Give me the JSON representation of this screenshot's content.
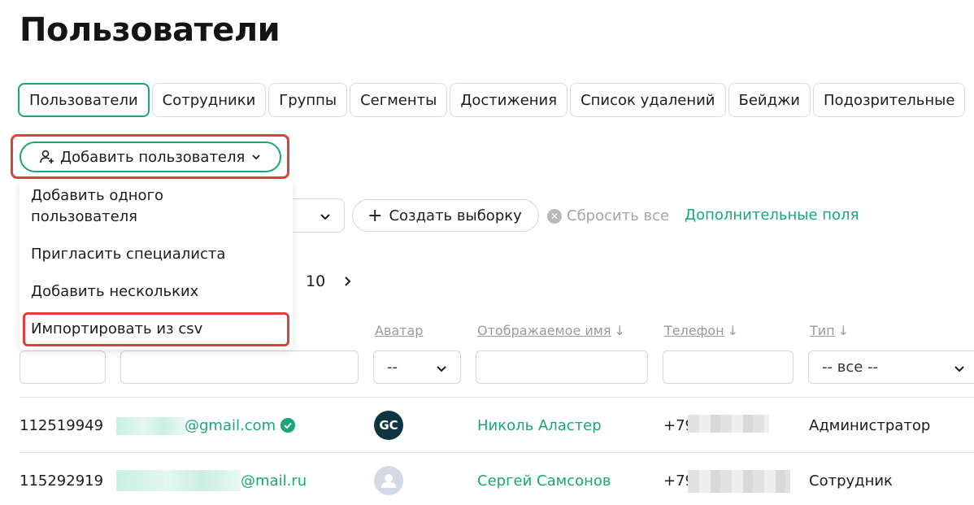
{
  "page": {
    "title": "Пользователи"
  },
  "tabs": [
    {
      "label": "Пользователи",
      "active": true
    },
    {
      "label": "Сотрудники"
    },
    {
      "label": "Группы"
    },
    {
      "label": "Сегменты"
    },
    {
      "label": "Достижения"
    },
    {
      "label": "Список удалений"
    },
    {
      "label": "Бейджи"
    },
    {
      "label": "Подозрительные"
    }
  ],
  "add_user": {
    "label": "Добавить пользователя",
    "menu": [
      "Добавить одного пользователя",
      "Пригласить специалиста",
      "Добавить нескольких",
      "Импортировать из csv"
    ]
  },
  "filters": {
    "create_selection": "Создать выборку",
    "reset_all": "Сбросить все",
    "extra_fields": "Дополнительные поля"
  },
  "pager": {
    "last_page": "10"
  },
  "columns": {
    "avatar": "Аватар",
    "display_name": "Отображаемое имя",
    "phone": "Телефон",
    "type": "Тип",
    "avatar_filter": "--",
    "type_filter": "-- все --"
  },
  "rows": [
    {
      "id": "112519949",
      "email": "@gmail.com",
      "verified": true,
      "avatar": "GC",
      "name": "Николь Аластер",
      "phone": "+79",
      "type": "Администратор"
    },
    {
      "id": "115292919",
      "email": "@mail.ru",
      "verified": false,
      "avatar": "",
      "name": "Сергей Самсонов",
      "phone": "+79",
      "type": "Сотрудник"
    }
  ],
  "colors": {
    "accent": "#1aa57a",
    "highlight": "#e0403a"
  }
}
